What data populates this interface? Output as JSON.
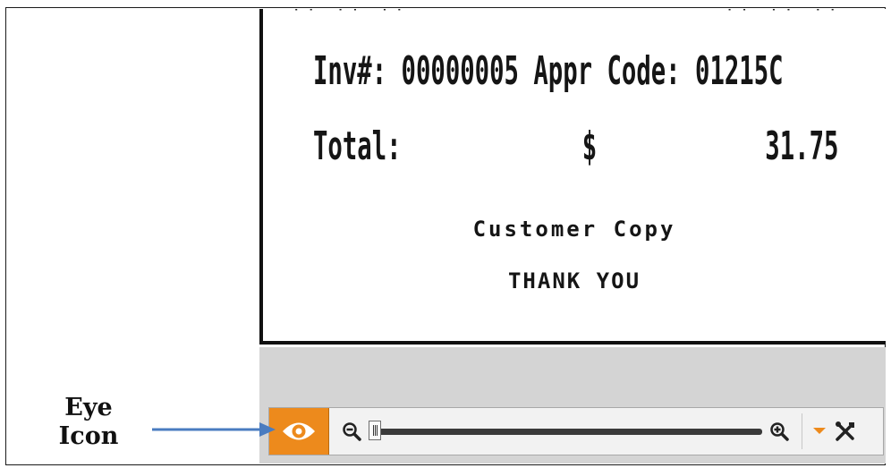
{
  "receipt": {
    "cutoff_left": "** ** **",
    "cutoff_right": "** ** **",
    "invoice_line": "Inv#: 00000005 Appr Code: 01215C",
    "total_label": "Total:",
    "currency_symbol": "$",
    "total_amount": "31.75",
    "customer_copy": "Customer Copy",
    "thank_you": "THANK YOU"
  },
  "toolbar": {
    "icons": [
      "eye-icon",
      "zoom-out-icon",
      "zoom-slider",
      "zoom-in-icon",
      "dropdown-arrow-icon",
      "tools-icon"
    ],
    "zoom_level": 0.0,
    "colors": {
      "eye_button": "#ed8a1c",
      "dropdown_arrow": "#ed8a1c"
    }
  },
  "annotation": {
    "label_line1": "Eye",
    "label_line2": "Icon",
    "arrow_color": "#4a7cc0"
  }
}
